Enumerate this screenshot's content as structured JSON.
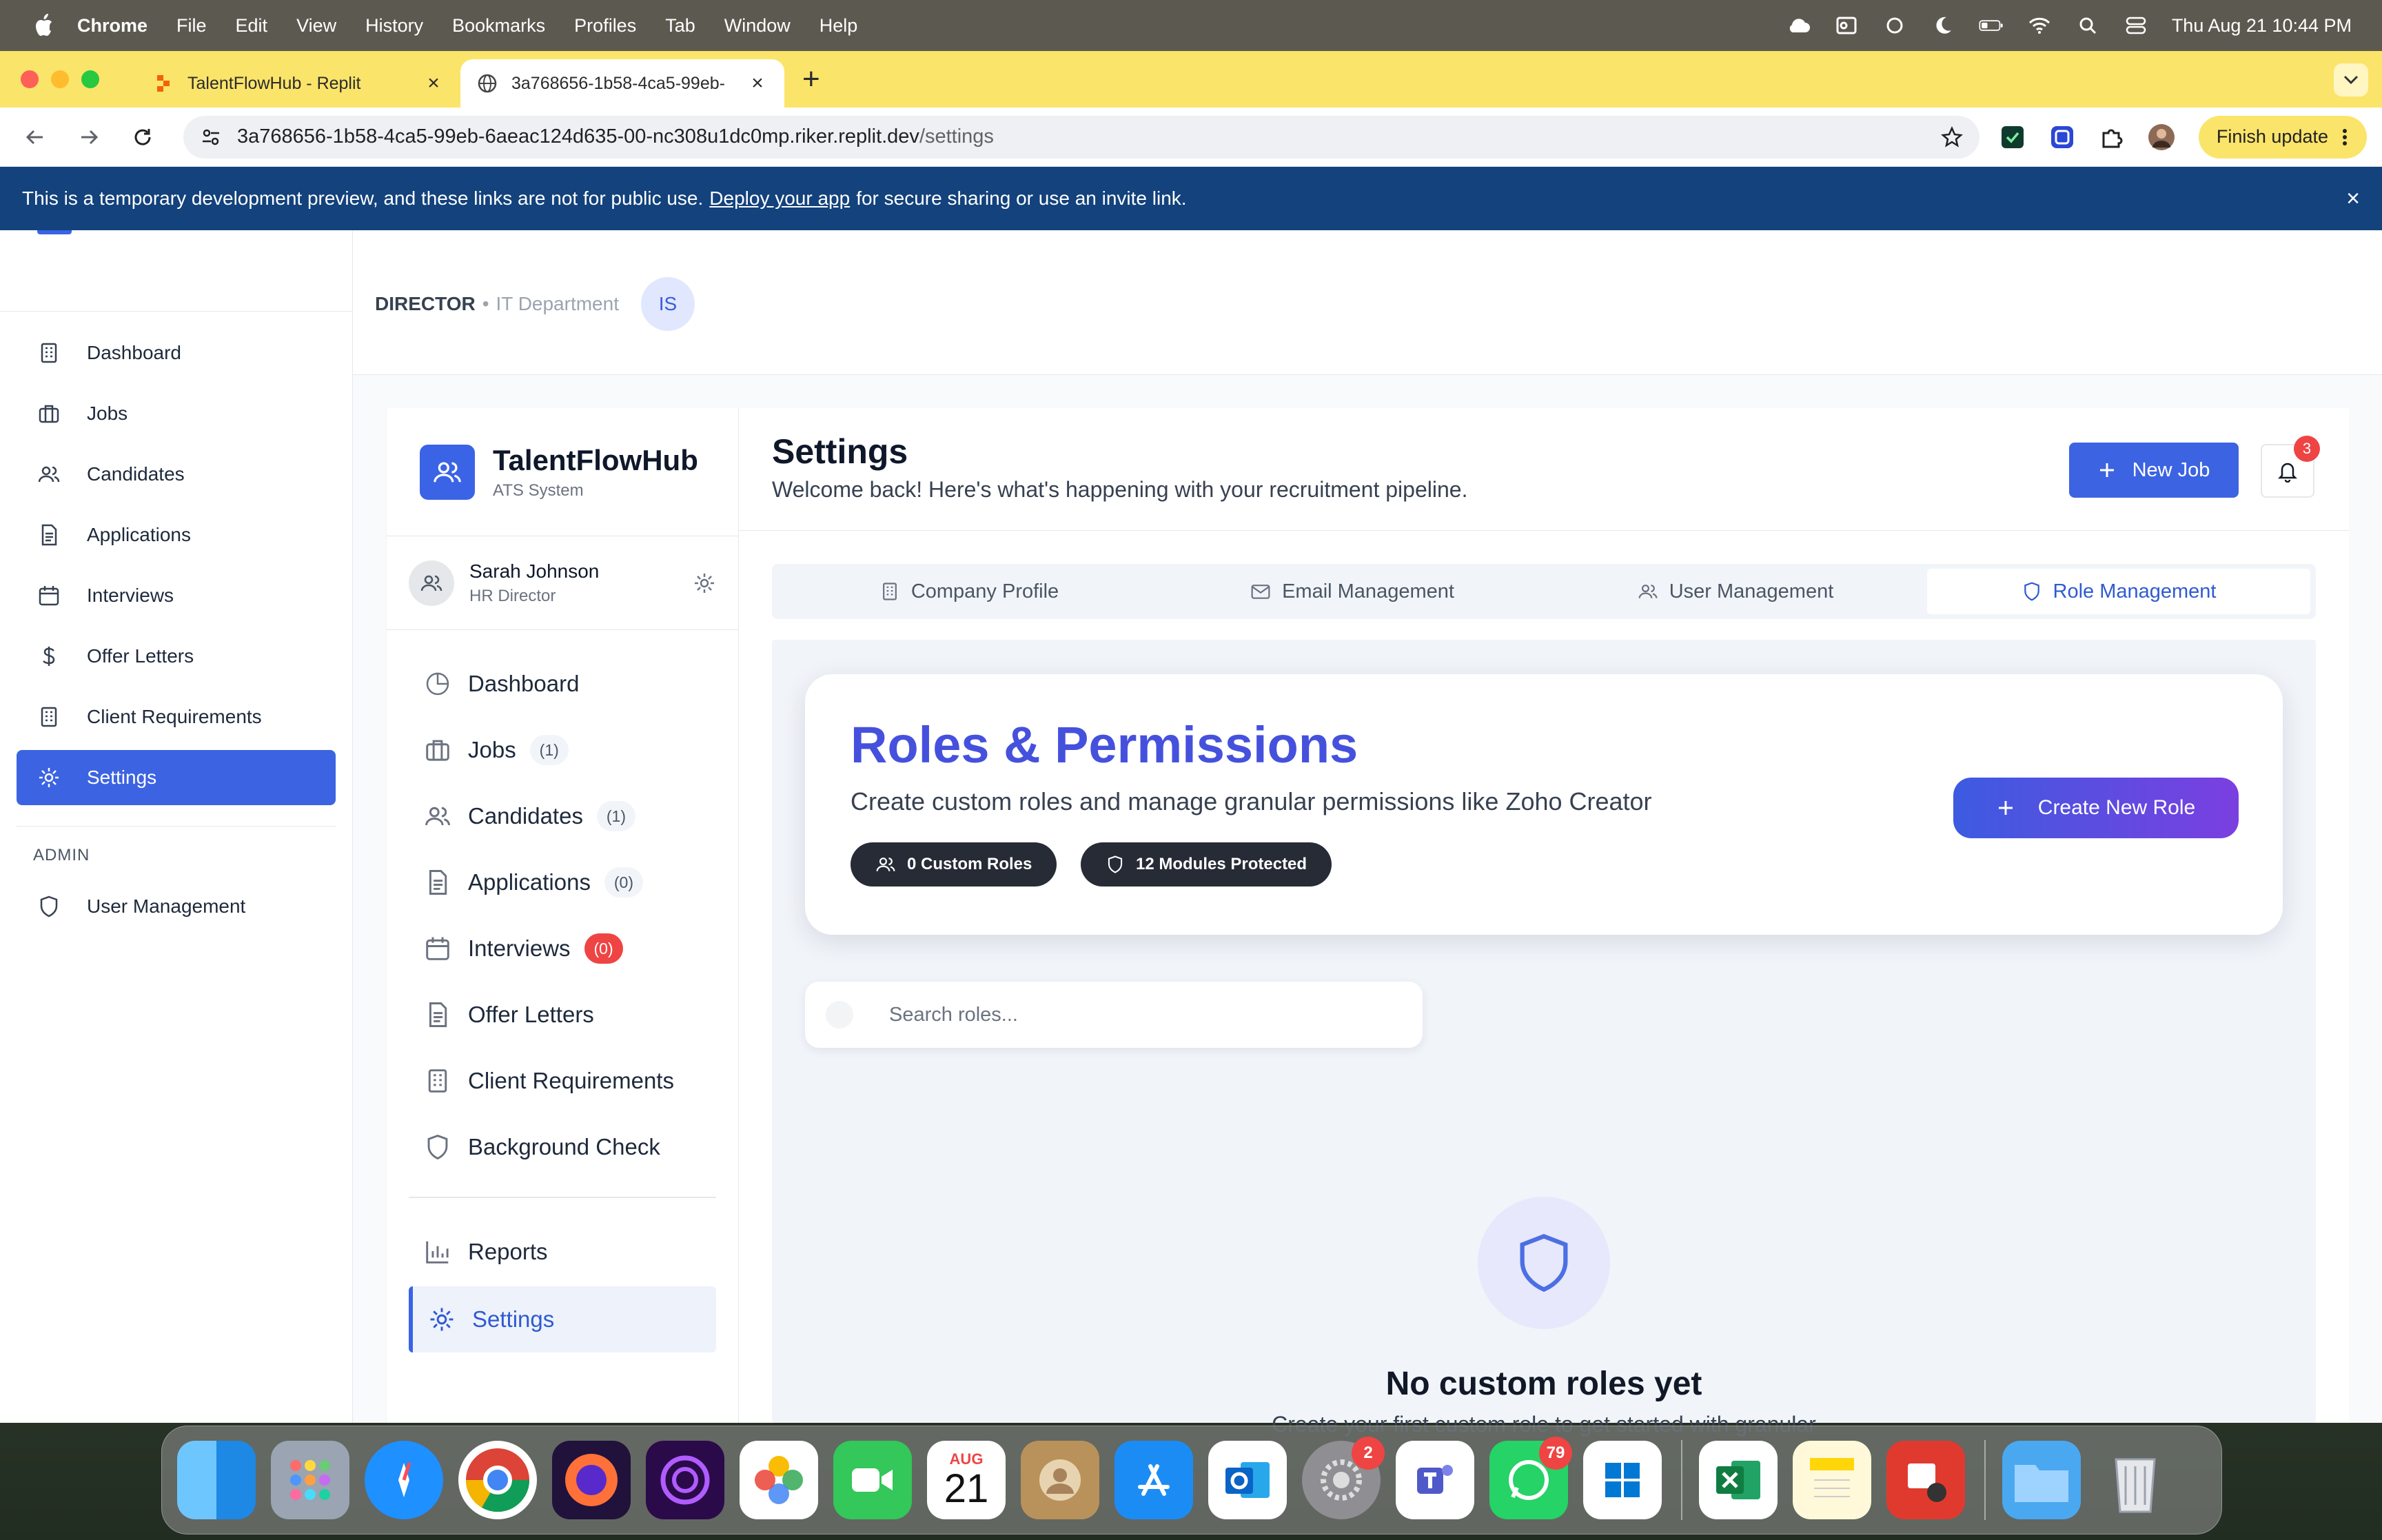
{
  "menubar": {
    "items": [
      "Chrome",
      "File",
      "Edit",
      "View",
      "History",
      "Bookmarks",
      "Profiles",
      "Tab",
      "Window",
      "Help"
    ],
    "datetime": "Thu Aug 21  10:44 PM"
  },
  "browser": {
    "tabs": [
      {
        "title": "TalentFlowHub - Replit",
        "active": false
      },
      {
        "title": "3a768656-1b58-4ca5-99eb-",
        "active": true
      }
    ],
    "url_host": "3a768656-1b58-4ca5-99eb-6aeac124d635-00-nc308u1dc0mp.riker.replit.dev",
    "url_path": "/settings",
    "finish_update": "Finish update"
  },
  "banner": {
    "before": "This is a temporary development preview, and these links are not for public use.",
    "link": "Deploy your app",
    "after": "for secure sharing or use an invite link."
  },
  "topbar": {
    "role": "DIRECTOR",
    "separator": "•",
    "department": "IT Department",
    "initials": "IS"
  },
  "outer_sidebar": {
    "items": [
      {
        "label": "Dashboard",
        "icon": "building-icon"
      },
      {
        "label": "Jobs",
        "icon": "briefcase-icon"
      },
      {
        "label": "Candidates",
        "icon": "users-icon"
      },
      {
        "label": "Applications",
        "icon": "file-icon"
      },
      {
        "label": "Interviews",
        "icon": "calendar-icon"
      },
      {
        "label": "Offer Letters",
        "icon": "dollar-icon"
      },
      {
        "label": "Client Requirements",
        "icon": "building-icon"
      },
      {
        "label": "Settings",
        "icon": "gear-icon",
        "active": true
      }
    ],
    "admin_label": "ADMIN",
    "admin_items": [
      {
        "label": "User Management",
        "icon": "shield-icon"
      }
    ]
  },
  "inner_sidebar": {
    "brand": "TalentFlowHub",
    "brand_sub": "ATS System",
    "user_name": "Sarah Johnson",
    "user_title": "HR Director",
    "items": [
      {
        "label": "Dashboard"
      },
      {
        "label": "Jobs",
        "badge": "(1)"
      },
      {
        "label": "Candidates",
        "badge": "(1)"
      },
      {
        "label": "Applications",
        "badge": "(0)"
      },
      {
        "label": "Interviews",
        "badge": "(0)"
      },
      {
        "label": "Offer Letters"
      },
      {
        "label": "Client Requirements"
      },
      {
        "label": "Background Check"
      }
    ],
    "reports": "Reports",
    "settings": "Settings"
  },
  "main": {
    "title": "Settings",
    "subtitle": "Welcome back! Here's what's happening with your recruitment pipeline.",
    "new_job": "New Job",
    "notifications": "3",
    "tabs": [
      "Company Profile",
      "Email Management",
      "User Management",
      "Role Management"
    ],
    "active_tab": "Role Management",
    "hero": {
      "title": "Roles & Permissions",
      "subtitle": "Create custom roles and manage granular permissions like Zoho Creator",
      "pill_roles": "0 Custom Roles",
      "pill_modules": "12 Modules Protected",
      "create_button": "Create New Role"
    },
    "search_placeholder": "Search roles...",
    "empty_title": "No custom roles yet",
    "empty_subtitle": "Create your first custom role to get started with granular"
  },
  "dock": {
    "calendar_month": "AUG",
    "calendar_day": "21",
    "badges": {
      "system_settings": "2",
      "whatsapp": "79"
    }
  },
  "colors": {
    "primary": "#3c63e2",
    "hero_title": "#4551dd",
    "banner": "#13427c",
    "chrome_yellow": "#fbe46a",
    "danger": "#ef4444"
  }
}
